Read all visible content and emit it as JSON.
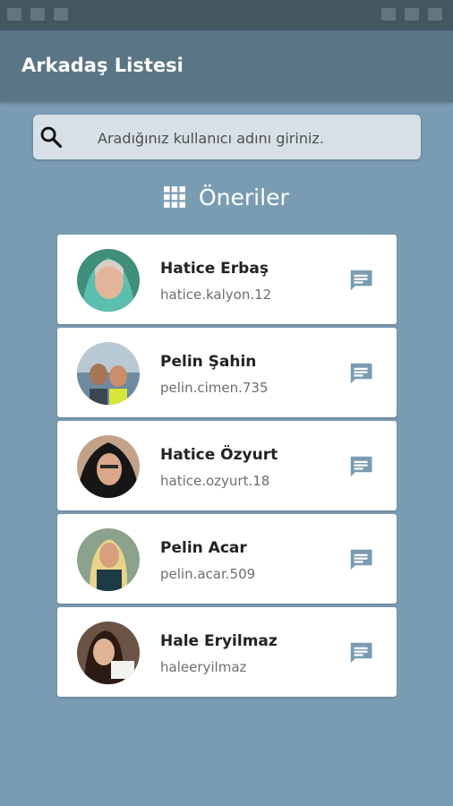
{
  "app": {
    "title": "Arkadaş Listesi"
  },
  "search": {
    "placeholder": "Aradığınız kullanıcı adını giriniz.",
    "icon": "search-icon"
  },
  "section": {
    "title": "Öneriler",
    "icon": "grid-icon"
  },
  "colors": {
    "background": "#7a9cb2",
    "app_bar": "#5a7585",
    "status_bar": "#435761",
    "search_bg": "#d6e0e6",
    "card": "#ffffff",
    "message_icon": "#7a9cb2"
  },
  "friends": [
    {
      "name": "Hatice Erbaş",
      "username": "hatice.kalyon.12",
      "action_icon": "message-icon"
    },
    {
      "name": "Pelin Şahin",
      "username": "pelin.cimen.735",
      "action_icon": "message-icon"
    },
    {
      "name": "Hatice Özyurt",
      "username": "hatice.ozyurt.18",
      "action_icon": "message-icon"
    },
    {
      "name": "Pelin Acar",
      "username": "pelin.acar.509",
      "action_icon": "message-icon"
    },
    {
      "name": "Hale Eryilmaz",
      "username": "haleeryilmaz",
      "action_icon": "message-icon"
    }
  ]
}
